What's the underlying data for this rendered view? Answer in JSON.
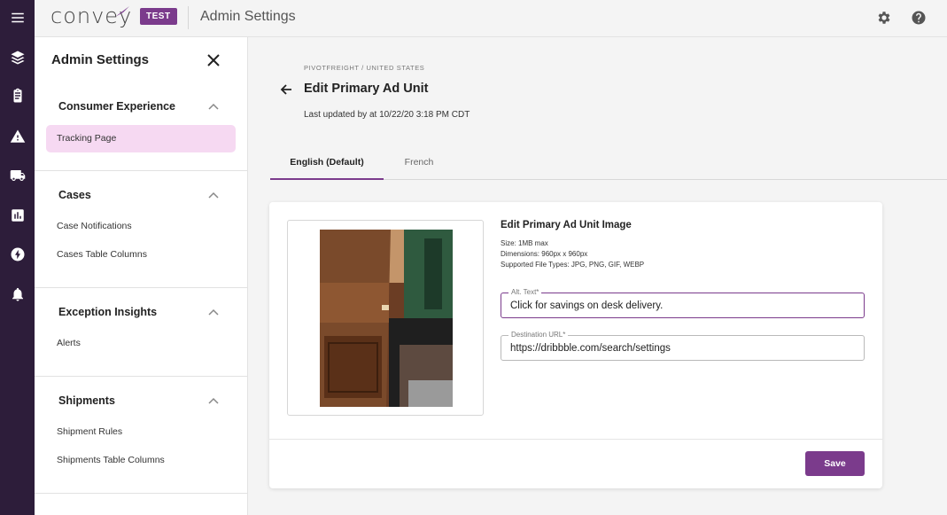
{
  "app": {
    "logo_text": "convey",
    "env_badge": "TEST",
    "title": "Admin Settings"
  },
  "rail": {
    "icons": [
      "menu-icon",
      "layers-icon",
      "clipboard-icon",
      "warning-icon",
      "truck-icon",
      "bar-chart-icon",
      "bolt-icon",
      "bell-icon"
    ]
  },
  "topbar": {
    "icons": [
      "gear-icon",
      "help-icon"
    ]
  },
  "settings_nav": {
    "title": "Admin Settings",
    "sections": [
      {
        "heading": "Consumer Experience",
        "items": [
          "Tracking Page"
        ],
        "active_item": "Tracking Page"
      },
      {
        "heading": "Cases",
        "items": [
          "Case Notifications",
          "Cases Table Columns"
        ]
      },
      {
        "heading": "Exception Insights",
        "items": [
          "Alerts"
        ]
      },
      {
        "heading": "Shipments",
        "items": [
          "Shipment Rules",
          "Shipments Table Columns"
        ]
      }
    ]
  },
  "main": {
    "breadcrumb": "PIVOTFREIGHT / UNITED STATES",
    "page_title": "Edit Primary Ad Unit",
    "last_updated": "Last updated by at 10/22/20 3:18 PM CDT",
    "tabs": [
      {
        "label": "English (Default)",
        "active": true
      },
      {
        "label": "French",
        "active": false
      }
    ],
    "card": {
      "heading": "Edit Primary Ad Unit Image",
      "size": "Size: 1MB max",
      "dimensions": "Dimensions: 960px x 960px",
      "file_types": "Supported File Types: JPG, PNG, GIF, WEBP",
      "alt_text_label": "Alt. Text*",
      "alt_text_value": "Click for savings on desk delivery.",
      "destination_label": "Destination URL*",
      "destination_value": "https://dribbble.com/search/settings",
      "save_label": "Save"
    }
  },
  "colors": {
    "brand_purple": "#7b3b8c",
    "rail_bg": "#2d1d3a",
    "active_nav_bg": "#f6d9f2"
  }
}
